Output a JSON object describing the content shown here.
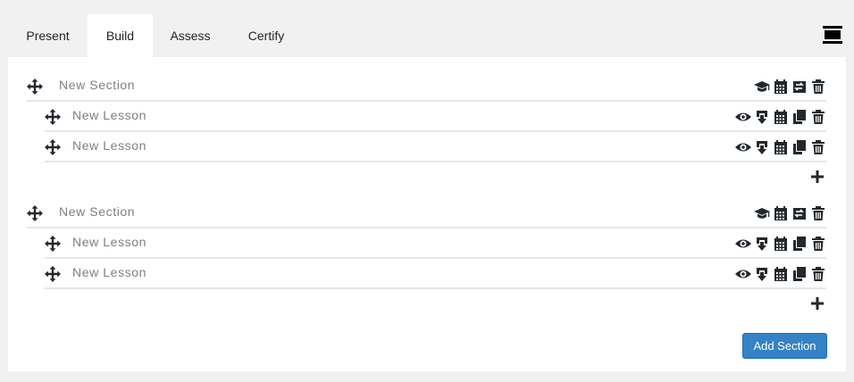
{
  "tabs": [
    {
      "label": "Present",
      "active": false
    },
    {
      "label": "Build",
      "active": true
    },
    {
      "label": "Assess",
      "active": false
    },
    {
      "label": "Certify",
      "active": false
    }
  ],
  "toolbar": {
    "menu_icon": "hamburger-menu-icon"
  },
  "sections": [
    {
      "title": "New Section",
      "actions": [
        "graduation-cap-icon",
        "calendar-icon",
        "swap-icon",
        "trash-icon"
      ],
      "lessons": [
        {
          "title": "New Lesson",
          "actions": [
            "eye-icon",
            "download-icon",
            "calendar-icon",
            "copy-icon",
            "trash-icon"
          ]
        },
        {
          "title": "New Lesson",
          "actions": [
            "eye-icon",
            "download-icon",
            "calendar-icon",
            "copy-icon",
            "trash-icon"
          ]
        }
      ],
      "add_icon": "plus-icon"
    },
    {
      "title": "New Section",
      "actions": [
        "graduation-cap-icon",
        "calendar-icon",
        "swap-icon",
        "trash-icon"
      ],
      "lessons": [
        {
          "title": "New Lesson",
          "actions": [
            "eye-icon",
            "download-icon",
            "calendar-icon",
            "copy-icon",
            "trash-icon"
          ]
        },
        {
          "title": "New Lesson",
          "actions": [
            "eye-icon",
            "download-icon",
            "calendar-icon",
            "copy-icon",
            "trash-icon"
          ]
        }
      ],
      "add_icon": "plus-icon"
    }
  ],
  "add_section_label": "Add Section",
  "colors": {
    "accent": "#3582c4",
    "background": "#f1f1f1",
    "panel": "#ffffff",
    "icon": "#23282d",
    "title_text": "#7b7f85"
  }
}
